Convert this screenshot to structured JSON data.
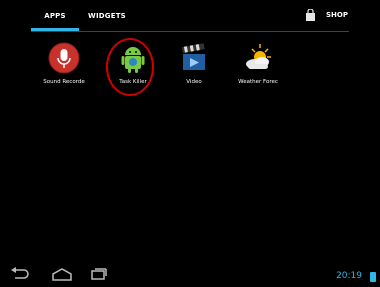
{
  "tabs": {
    "apps": "APPS",
    "widgets": "WIDGETS",
    "shop": "SHOP"
  },
  "apps": [
    {
      "label": "Sound Recorde",
      "icon": "microphone-icon"
    },
    {
      "label": "Task Killer",
      "icon": "android-icon"
    },
    {
      "label": "Video",
      "icon": "clapperboard-icon"
    },
    {
      "label": "Weather Forec",
      "icon": "weather-icon"
    }
  ],
  "status": {
    "time": "20:19"
  },
  "colors": {
    "accent": "#33b5e5",
    "highlight": "#d00000"
  },
  "nav": {
    "back_icon": "back-icon",
    "home_icon": "home-icon",
    "recent_icon": "recent-apps-icon"
  }
}
